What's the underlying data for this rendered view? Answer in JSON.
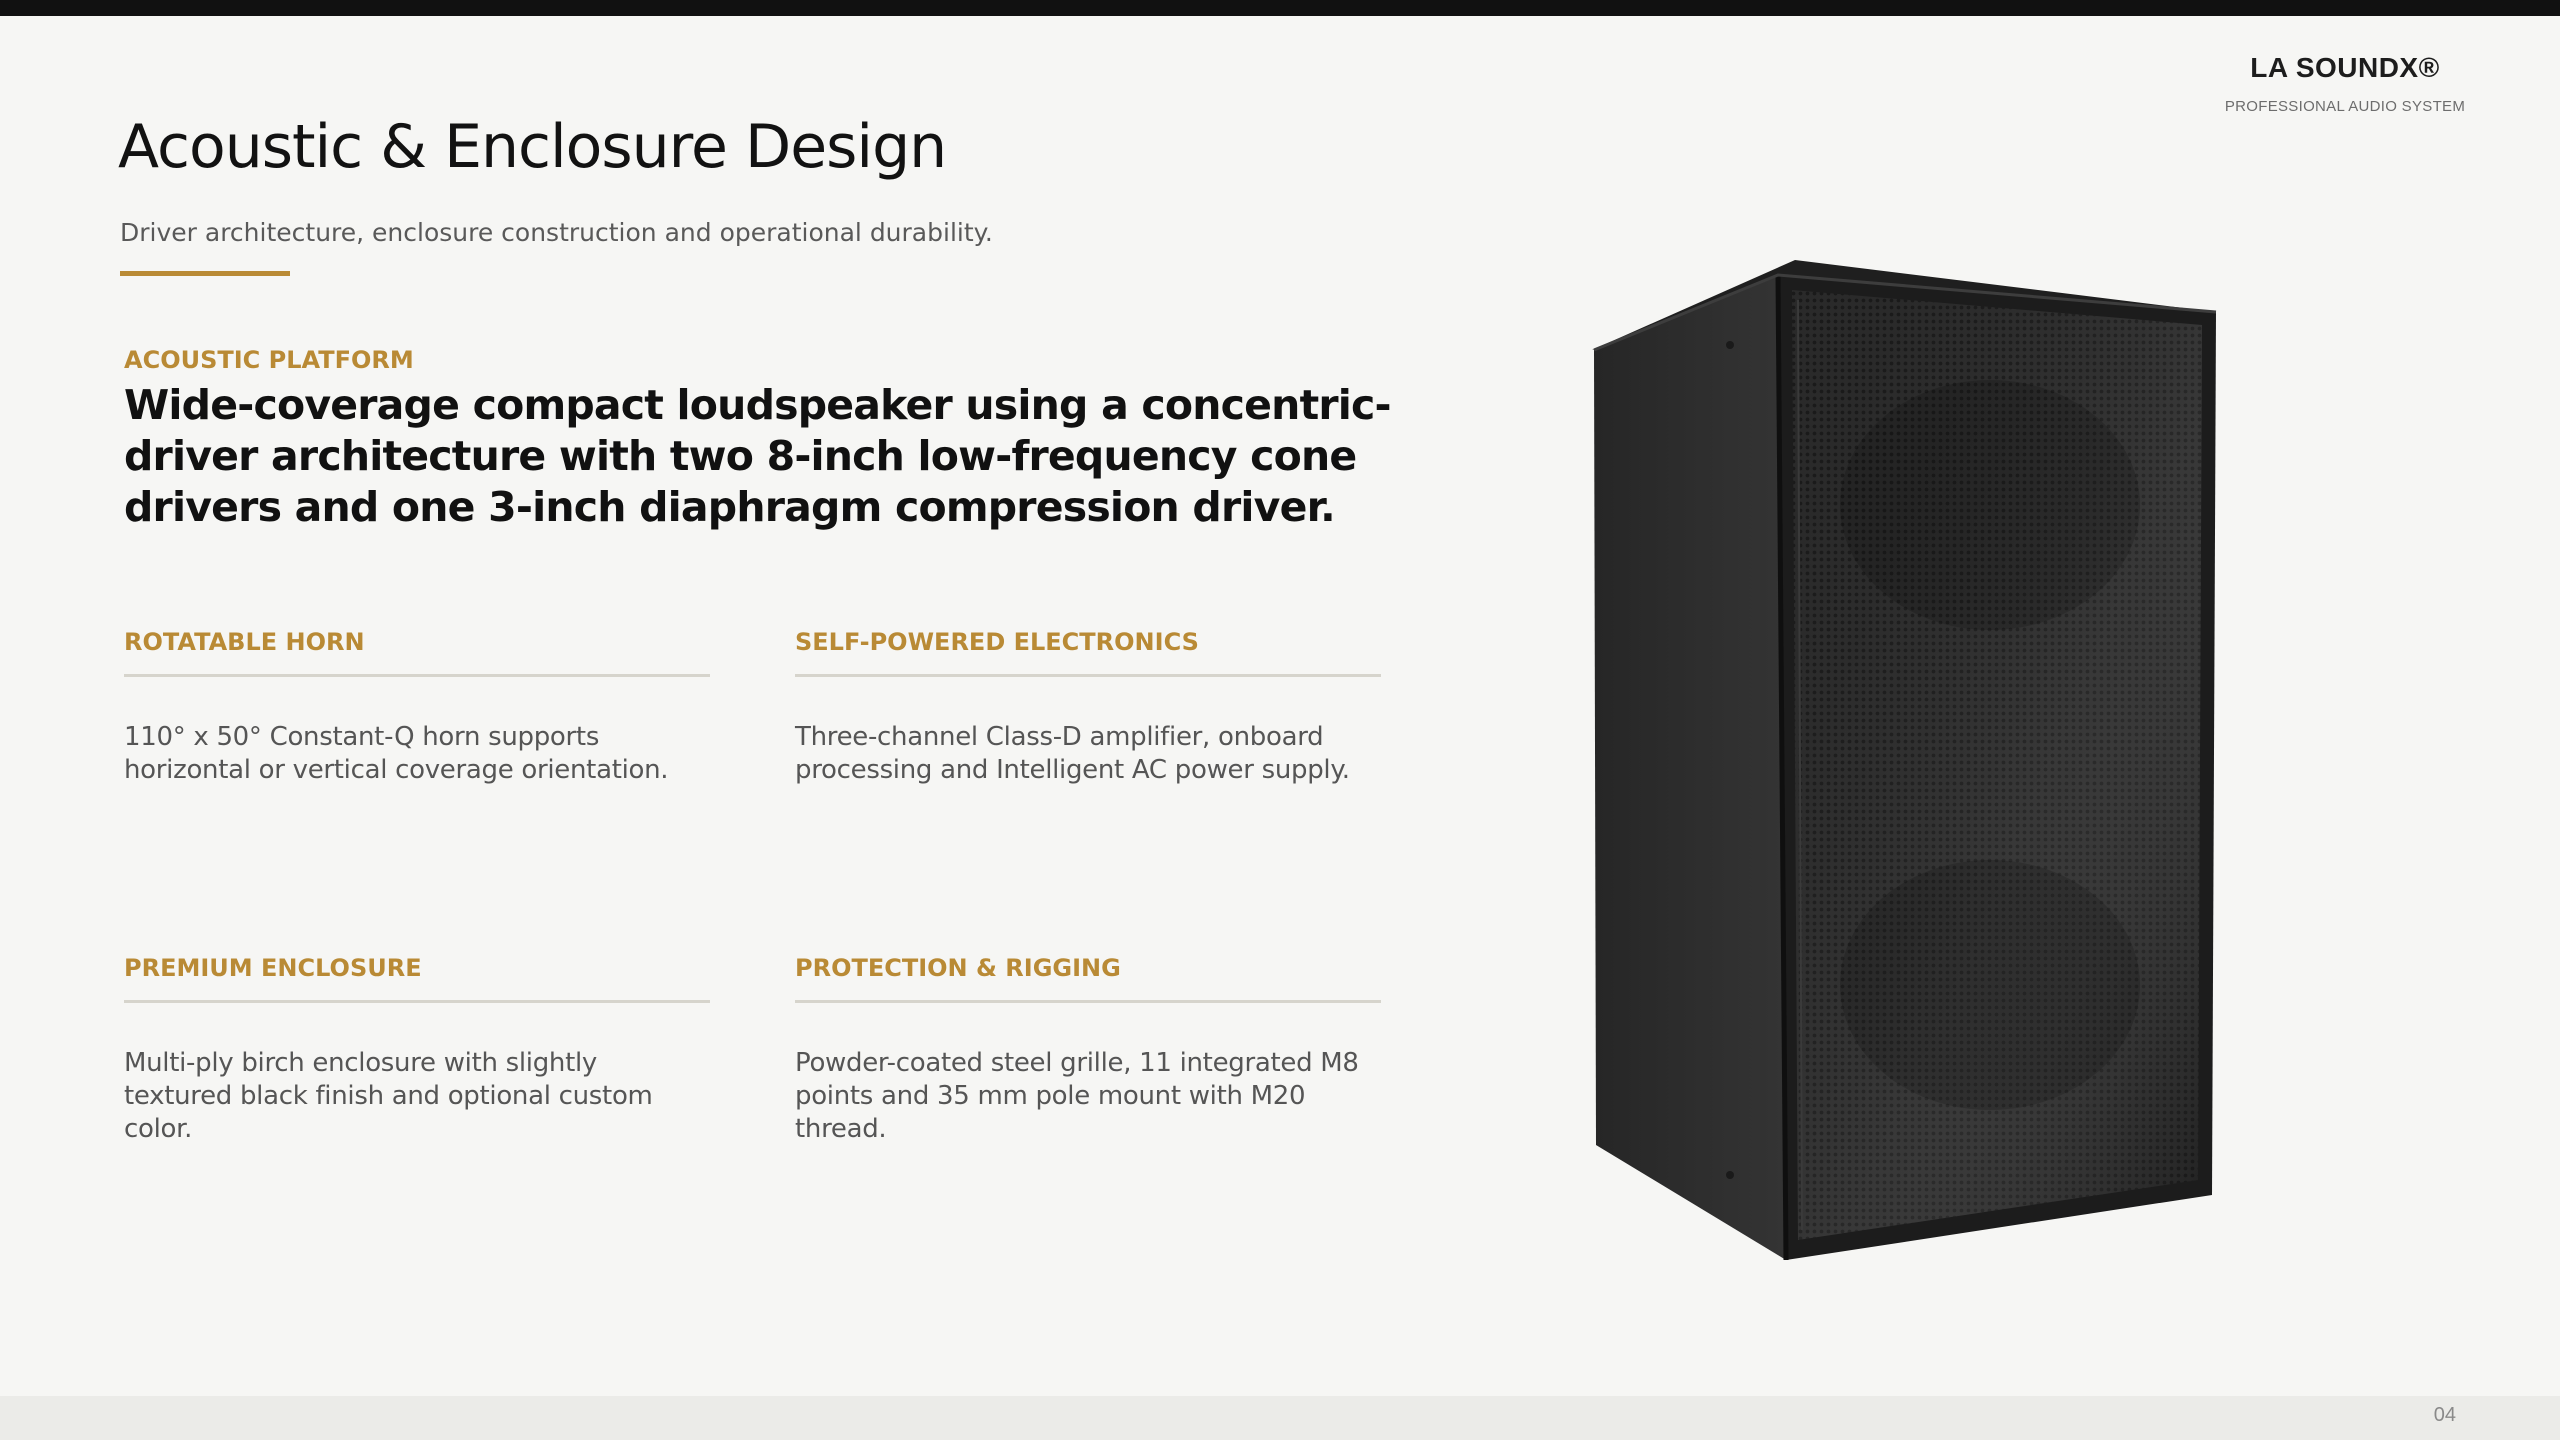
{
  "brand": {
    "name": "LA SOUNDX®",
    "tagline": "PROFESSIONAL AUDIO SYSTEM"
  },
  "header": {
    "title": "Acoustic & Enclosure Design",
    "subtitle": "Driver architecture, enclosure construction and operational durability."
  },
  "intro": {
    "kicker": "ACOUSTIC PLATFORM",
    "lead": "Wide-coverage compact loudspeaker using a concentric-driver architecture with two 8-inch low-frequency cone drivers and one 3-inch diaphragm compression driver."
  },
  "features": [
    {
      "title": "ROTATABLE HORN",
      "body": "110° x 50° Constant-Q horn supports horizontal or vertical coverage orientation."
    },
    {
      "title": "SELF-POWERED ELECTRONICS",
      "body": "Three-channel Class-D amplifier, onboard processing and Intelligent AC power supply."
    },
    {
      "title": "PREMIUM ENCLOSURE",
      "body": "Multi-ply birch enclosure with slightly textured black finish and optional custom color."
    },
    {
      "title": "PROTECTION & RIGGING",
      "body": "Powder-coated steel grille, 11 integrated M8 points and 35 mm pole mount with M20 thread."
    }
  ],
  "footer": {
    "page_number": "04"
  },
  "colors": {
    "accent": "#b98a35",
    "background": "#f6f6f4",
    "top_bar": "#111111",
    "footer_band": "#ebebe8"
  },
  "image": {
    "subject": "loudspeaker-cabinet"
  }
}
